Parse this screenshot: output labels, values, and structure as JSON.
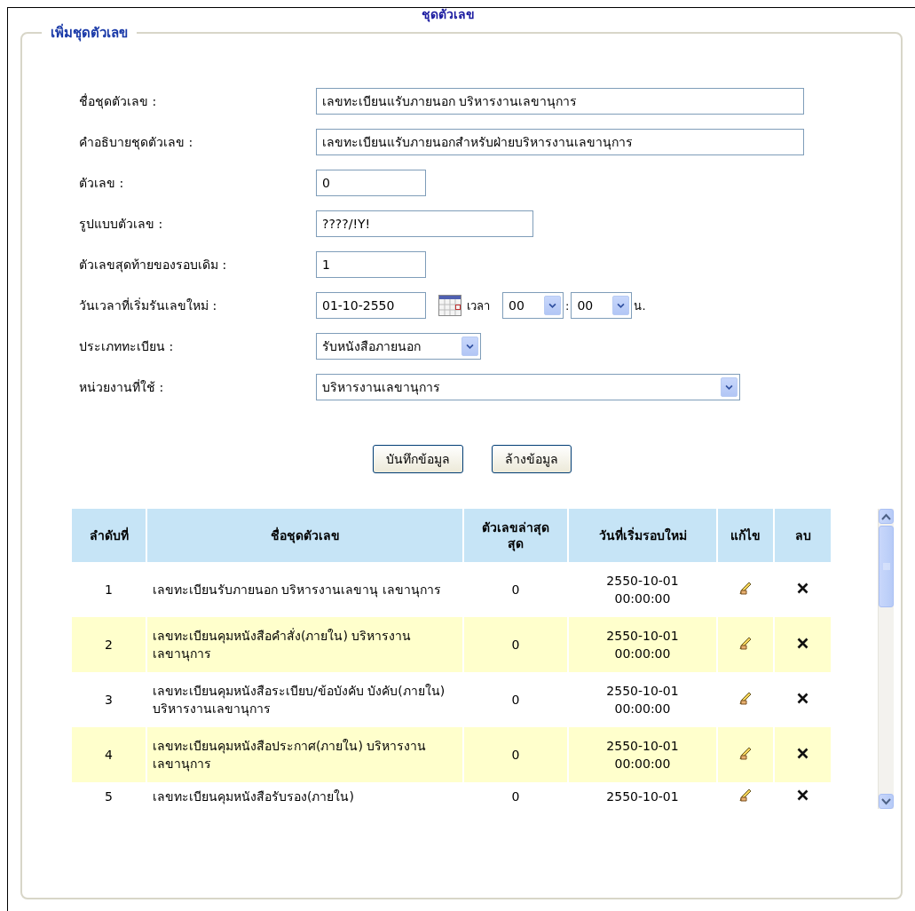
{
  "page_title": "ชุดตัวเลข",
  "section": {
    "legend": "เพิ่มชุดตัวเลข"
  },
  "form": {
    "fields": [
      {
        "kind": "text",
        "label": "ชื่อชุดตัวเลข :",
        "value": "เลขทะเบียนแรับภายนอก บริหารงานเลขานุการ"
      },
      {
        "kind": "text",
        "label": "คำอธิบายชุดตัวเลข :",
        "value": "เลขทะเบียนแรับภายนอกสำหรับฝ่ายบริหารงานเลขานุการ"
      },
      {
        "kind": "text",
        "label": "ตัวเลข :",
        "value": "0"
      },
      {
        "kind": "text",
        "label": "รูปแบบตัวเลข :",
        "value": "????/!Y!"
      },
      {
        "kind": "text",
        "label": "ตัวเลขสุดท้ายของรอบเดิม :",
        "value": "1"
      },
      {
        "kind": "datetime",
        "label": "วันเวลาที่เริ่มรันเลขใหม่ :",
        "value": "01-10-2550",
        "time_label": "เวลา",
        "hour": "00",
        "separator": ":",
        "minute": "00",
        "suffix": "น."
      },
      {
        "kind": "select",
        "label": "ประเภททะเบียน :",
        "value": "รับหนังสือภายนอก"
      },
      {
        "kind": "select",
        "label": "หน่วยงานที่ใช้ :",
        "value": "บริหารงานเลขานุการ"
      }
    ],
    "buttons": [
      "บันทึกข้อมูล",
      "ล้างข้อมูล"
    ]
  },
  "table": {
    "columns": [
      "ลำดับที่",
      "ชื่อชุดตัวเลข",
      "ตัวเลขล่าสุด สุด",
      "วันที่เริ่มรอบใหม่",
      "แก้ไข",
      "ลบ"
    ],
    "rows": [
      {
        "index": "1",
        "name": "เลขทะเบียนรับภายนอก บริหารงานเลขานุ เลขานุการ",
        "latest": "0",
        "start": "2550-10-01 00:00:00"
      },
      {
        "index": "2",
        "name": "เลขทะเบียนคุมหนังสือคำสั่ง(ภายใน) บริหารงานเลขานุการ",
        "latest": "0",
        "start": "2550-10-01 00:00:00"
      },
      {
        "index": "3",
        "name": "เลขทะเบียนคุมหนังสือระเบียบ/ข้อบังคับ บังคับ(ภายใน) บริหารงานเลขานุการ",
        "latest": "0",
        "start": "2550-10-01 00:00:00"
      },
      {
        "index": "4",
        "name": "เลขทะเบียนคุมหนังสือประกาศ(ภายใน) บริหารงานเลขานุการ",
        "latest": "0",
        "start": "2550-10-01 00:00:00"
      },
      {
        "index": "5",
        "name": "เลขทะเบียนคุมหนังสือรับรอง(ภายใน)",
        "latest": "0",
        "start": "2550-10-01"
      }
    ]
  }
}
